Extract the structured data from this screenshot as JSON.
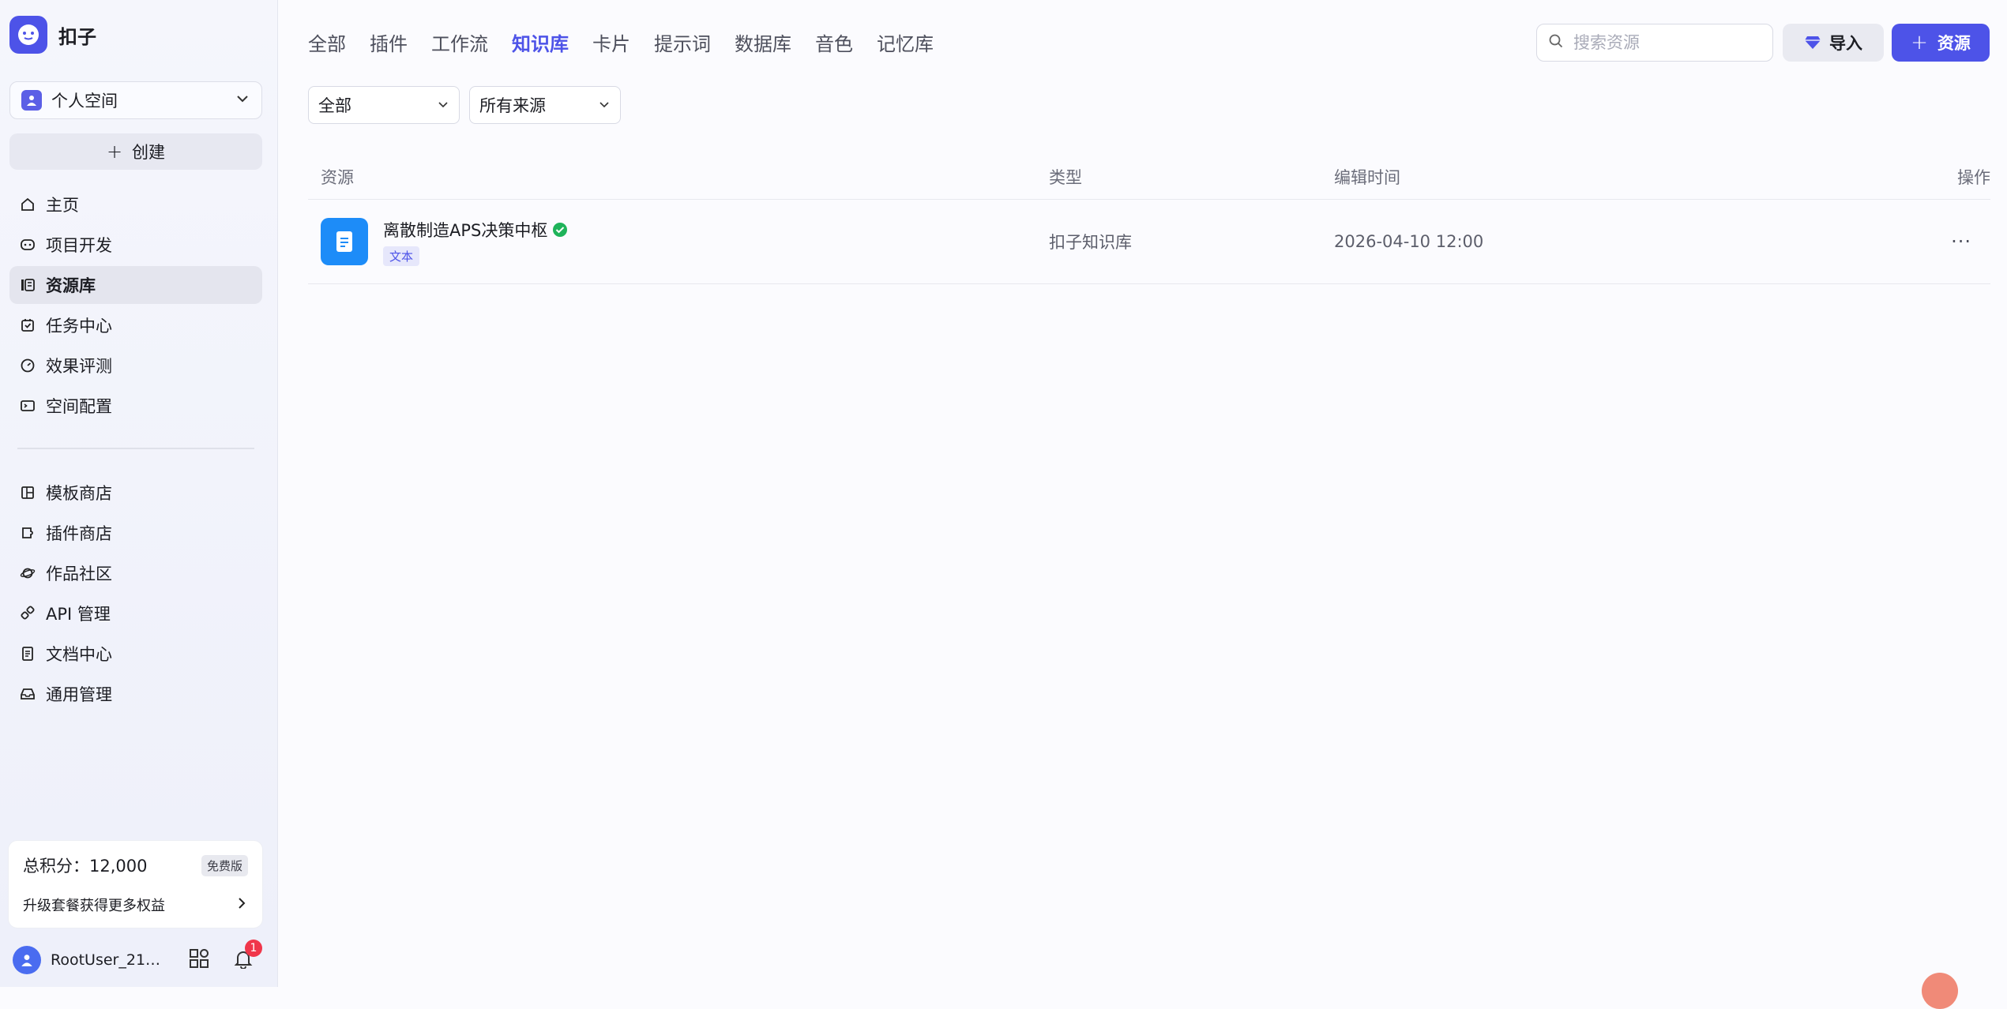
{
  "brand": {
    "name": "扣子",
    "color": "#4d53e8"
  },
  "sidebar": {
    "space": "个人空间",
    "create_label": "创建",
    "nav_primary": [
      {
        "label": "主页",
        "icon": "home-icon"
      },
      {
        "label": "项目开发",
        "icon": "robot-icon"
      },
      {
        "label": "资源库",
        "icon": "library-icon",
        "active": true
      },
      {
        "label": "任务中心",
        "icon": "task-icon"
      },
      {
        "label": "效果评测",
        "icon": "gauge-icon"
      },
      {
        "label": "空间配置",
        "icon": "terminal-icon"
      }
    ],
    "nav_secondary": [
      {
        "label": "模板商店",
        "icon": "template-icon"
      },
      {
        "label": "插件商店",
        "icon": "plugin-icon"
      },
      {
        "label": "作品社区",
        "icon": "planet-icon"
      },
      {
        "label": "API 管理",
        "icon": "link-icon"
      },
      {
        "label": "文档中心",
        "icon": "document-icon"
      },
      {
        "label": "通用管理",
        "icon": "inbox-icon"
      }
    ],
    "credits": {
      "label": "总积分：12,000",
      "plan_badge": "免费版",
      "upgrade_label": "升级套餐获得更多权益"
    },
    "user": {
      "name": "RootUser_210…",
      "notification_count": "1"
    }
  },
  "main": {
    "tabs": [
      "全部",
      "插件",
      "工作流",
      "知识库",
      "卡片",
      "提示词",
      "数据库",
      "音色",
      "记忆库"
    ],
    "active_tab": "知识库",
    "search_placeholder": "搜索资源",
    "import_label": "导入",
    "add_label": "资源",
    "filters": {
      "type": "全部",
      "source": "所有来源"
    },
    "table": {
      "headers": {
        "resource": "资源",
        "type": "类型",
        "edit_time": "编辑时间",
        "actions": "操作"
      },
      "rows": [
        {
          "name": "离散制造APS决策中枢",
          "tag": "文本",
          "type": "扣子知识库",
          "edit_time": "2026-04-10 12:00",
          "status": "published"
        }
      ]
    }
  },
  "colors": {
    "accent": "#4d53e8",
    "doc_icon": "#1d8cf8",
    "success": "#1fb35a",
    "badge_red": "#f0364a"
  }
}
